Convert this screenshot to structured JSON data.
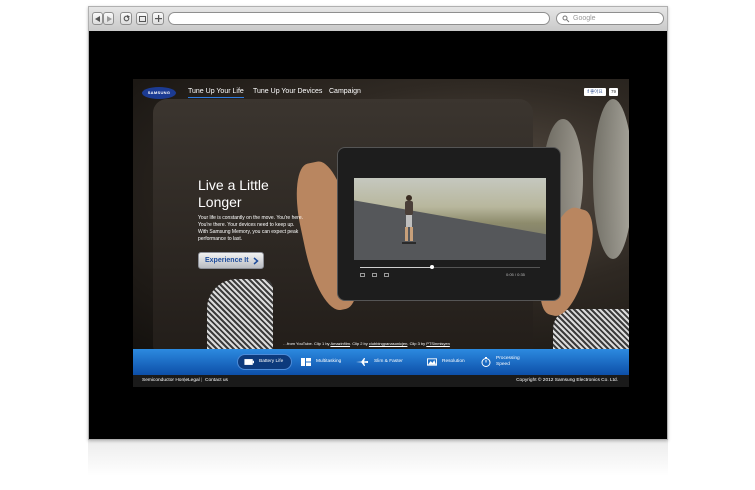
{
  "browser": {
    "search_placeholder": "Google"
  },
  "nav": {
    "logo_text": "SAMSUNG",
    "items": [
      {
        "label": "Tune Up Your Life"
      },
      {
        "label": "Tune Up Your Devices"
      },
      {
        "label": "Campaign"
      }
    ],
    "facebook_label": "좋아요",
    "count": "79"
  },
  "hero": {
    "headline_line1": "Live a Little",
    "headline_line2": "Longer",
    "body_lines": [
      "Your life is constantly on the move. You're here.",
      "You're there. Your devices need to keep up.",
      "With Samsung Memory, you can expect peak",
      "performance to last."
    ],
    "cta_label": "Experience It",
    "credit_prefix": "…from YouTube. Clip 1 by ",
    "credit_link1": "Amazinfilm",
    "credit_mid": ". Clip 2 by ",
    "credit_link2": "clubbingpanasonicjen",
    "credit_mid2": ". Clip 3 by ",
    "credit_link3": "PTSinmisyen",
    "video_time": "0:05 / 0:35"
  },
  "features": [
    {
      "label": "Battery Life",
      "icon": "battery-icon",
      "selected": true
    },
    {
      "label": "Multitasking",
      "icon": "multitask-icon",
      "selected": false
    },
    {
      "label": "Slim & Faster",
      "icon": "plane-icon",
      "selected": false
    },
    {
      "label": "Resolution",
      "icon": "image-icon",
      "selected": false
    },
    {
      "label": "Processing Speed",
      "icon": "stopwatch-icon",
      "selected": false
    }
  ],
  "footer": {
    "links": [
      "Semiconductor Home",
      "Legal",
      "Contact us"
    ],
    "copyright": "Copyright © 2012 Samsung Electronics Co. Ltd."
  },
  "colors": {
    "accent_blue": "#1e63c4",
    "logo_blue": "#1c3b93",
    "page_bg": "#000000"
  }
}
